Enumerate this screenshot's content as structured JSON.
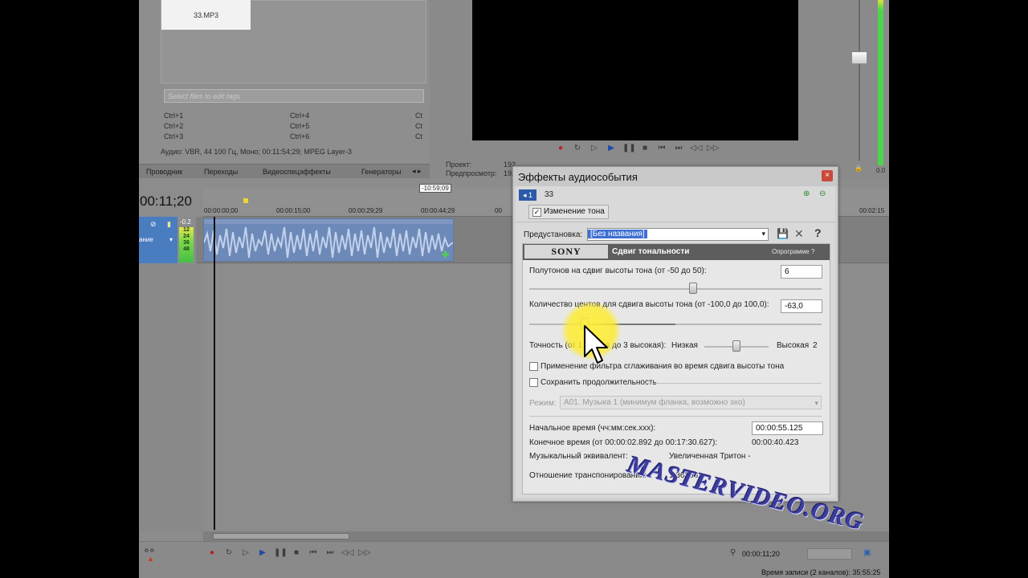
{
  "explorer": {
    "selected_file": "33.MP3",
    "tags_placeholder": "Select files to edit tags",
    "shortcuts": {
      "col1": [
        "Ctrl+1",
        "Ctrl+2",
        "Ctrl+3"
      ],
      "col2": [
        "Ctrl+4",
        "Ctrl+5",
        "Ctrl+6"
      ],
      "col3": [
        "Ct",
        "Ct",
        "Ct"
      ]
    },
    "audio_info": "Аудио: VBR, 44 100 Гц, Моно; 00:11:54;29; MPEG Layer-3",
    "tabs": [
      "Проводник",
      "Переходы",
      "Видеоспецэффекты",
      "Генераторы"
    ]
  },
  "preview": {
    "project_label": "Проект:",
    "project_value": "192",
    "preview_label": "Предпросмотр:",
    "preview_value": "192"
  },
  "mixer": {
    "meter_value": "0.0"
  },
  "timeline": {
    "current_time": "00:11;20",
    "ruler_marker": "-10:59;09",
    "ruler_ticks": [
      "00:00:00;00",
      "00:00:15;00",
      "00:00:29;29",
      "00:00:44;29",
      "00",
      "00:02:15"
    ],
    "track_level": "-0.2",
    "track_label": "ание",
    "meter_ticks": [
      "12",
      "24",
      "36",
      "48"
    ],
    "bottom_time": "00:00:11;20",
    "status": "Время записи (2 каналов): 35:55:25"
  },
  "dialog": {
    "title": "Эффекты аудиособытия",
    "close_label": "×",
    "chain_button": "1",
    "chain_name": "33",
    "chain_item": "Изменение тона",
    "preset_label": "Предустановка:",
    "preset_value": "[Без названия]",
    "help_label": "?",
    "sony_logo": "SONY",
    "plugin_name": "Сдвиг тональности",
    "about_label": "Опрограмме",
    "semitones_label": "Полутонов на сдвиг высоты тона (от -50 до 50):",
    "semitones_value": "6",
    "semitones_level": 0.56,
    "cents_label": "Количество центов для сдвига высоты тона (от -100,0 до 100,0):",
    "cents_value": "-63,0",
    "cents_level": 0.19,
    "accuracy_label": "Точность (от 1 низкая до 3 высокая):",
    "accuracy_low": "Низкая",
    "accuracy_high": "Высокая",
    "accuracy_value": "2",
    "accuracy_level": 0.5,
    "antialias_label": "Применение фильтра сглаживания во время сдвига высоты тона",
    "preserve_label": "Сохранить продолжительность",
    "mode_label": "Режим:",
    "mode_value": "A01. Музыка 1 (минимум фланка, возможно эхо)",
    "start_time_label": "Начальное время (чч:мм:сек.ххх):",
    "start_time_value": "00:00:55.125",
    "end_time_label": "Конечное время (от 00:00:02.892 до 00:17:30.627):",
    "end_time_value": "00:00:40.423",
    "musical_eq_label": "Музыкальный эквивалент:",
    "musical_eq_value": "Увеличенная Тритон -",
    "ratio_label": "Отношение транспонирования:",
    "ratio_value": "1,36368"
  },
  "watermark": "MASTERVIDEO.ORG",
  "colors": {
    "accent_blue": "#2c5aa8",
    "track_blue": "#4a7cc0",
    "meter_green": "#44c044",
    "cursor_highlight": "#ffeb28"
  }
}
